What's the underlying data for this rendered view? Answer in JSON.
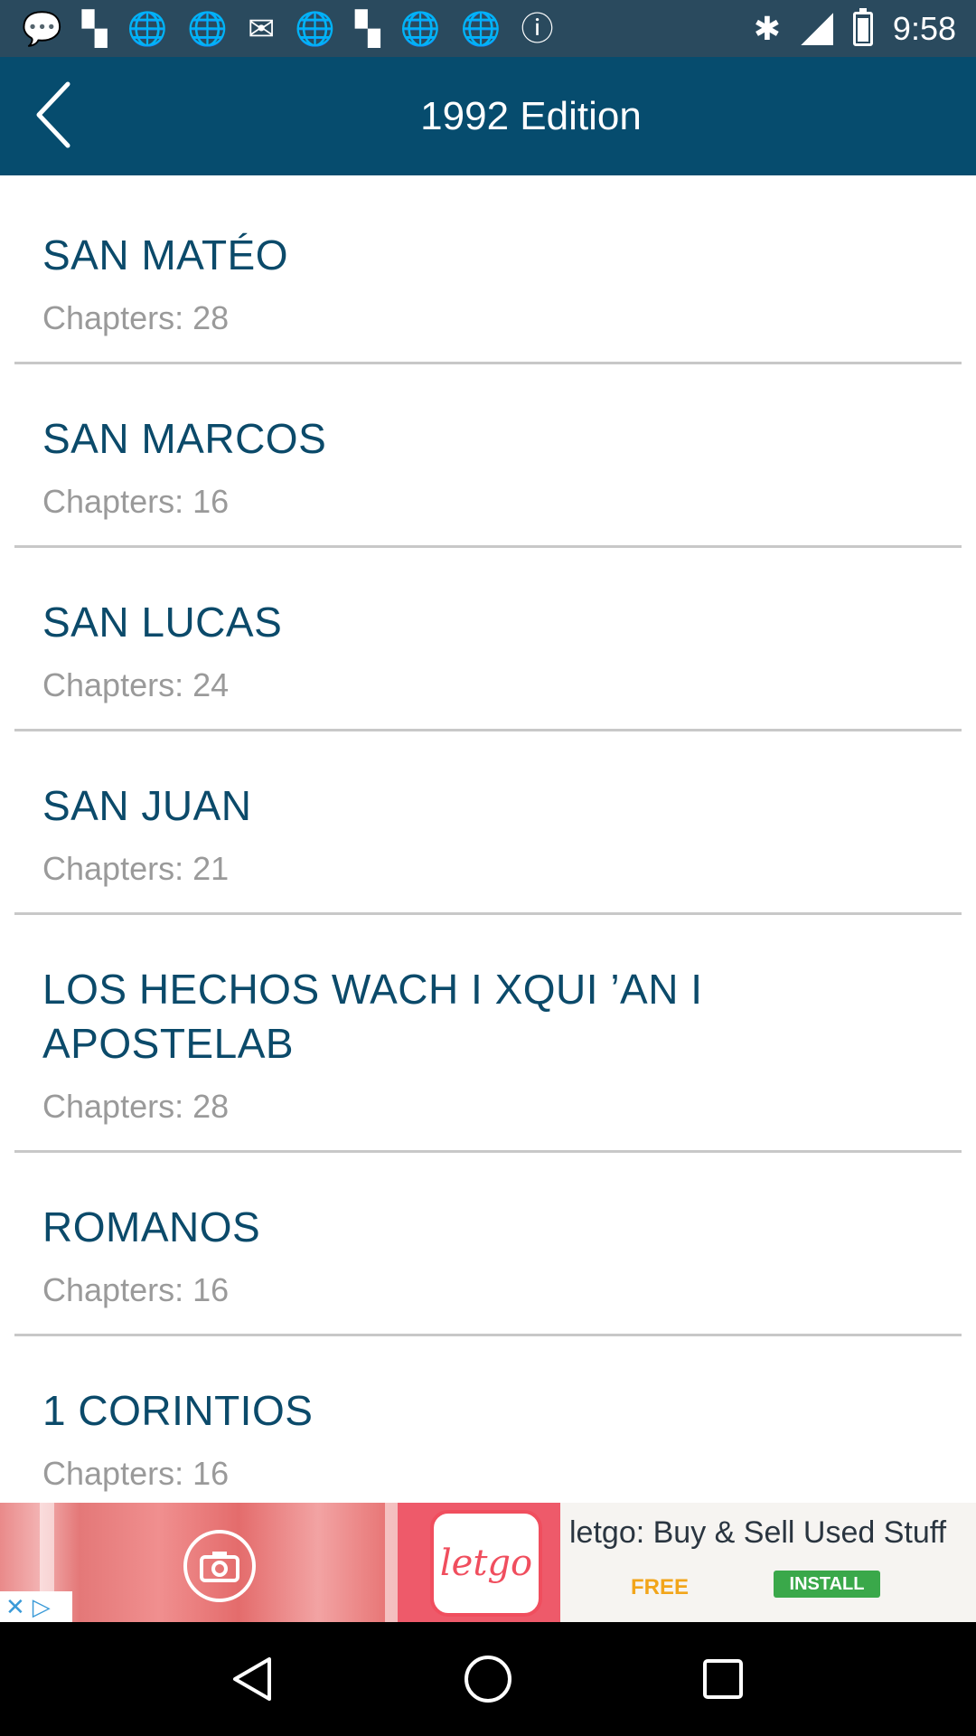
{
  "status_bar": {
    "time": "9:58"
  },
  "app_bar": {
    "title": "1992 Edition"
  },
  "books": [
    {
      "title": "SAN MATÉO",
      "chapters": "Chapters: 28"
    },
    {
      "title": "SAN MARCOS",
      "chapters": "Chapters: 16"
    },
    {
      "title": "SAN LUCAS",
      "chapters": "Chapters: 24"
    },
    {
      "title": "SAN JUAN",
      "chapters": "Chapters: 21"
    },
    {
      "title": "LOS HECHOS WACH I XQUI ’AN I APOSTELAB",
      "chapters": "Chapters: 28"
    },
    {
      "title": "ROMANOS",
      "chapters": "Chapters: 16"
    },
    {
      "title": "1 CORINTIOS",
      "chapters": "Chapters: 16"
    }
  ],
  "ad": {
    "logo_text": "letgo",
    "headline": "letgo: Buy & Sell Used Stuff",
    "free_label": "FREE",
    "install_label": "INSTALL"
  },
  "colors": {
    "app_bar": "#064c6e",
    "title_text": "#0b4a6a",
    "subtitle_text": "#9a9a9a",
    "divider": "#c8c8c8"
  }
}
